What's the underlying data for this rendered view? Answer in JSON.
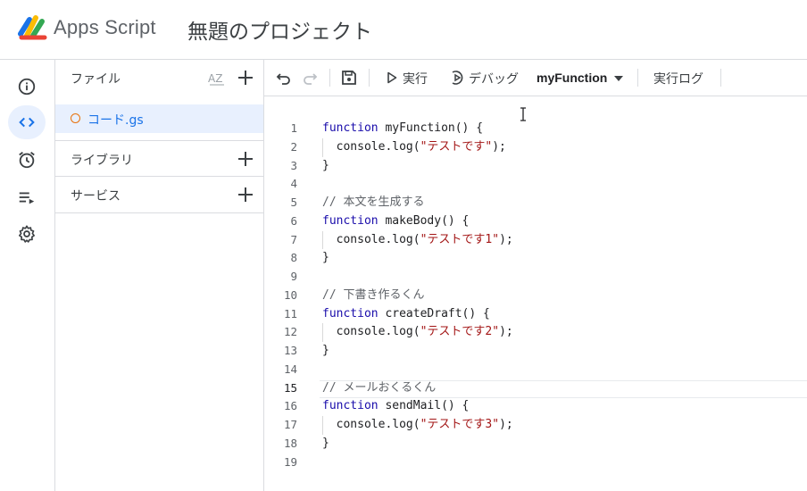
{
  "header": {
    "app_name": "Apps Script",
    "project_title": "無題のプロジェクト"
  },
  "rail": {
    "items": [
      "info-icon",
      "code-icon",
      "alarm-icon",
      "executions-icon",
      "gear-icon"
    ],
    "active_index": 1
  },
  "files_panel": {
    "title": "ファイル",
    "files": [
      {
        "name": "コード.gs",
        "selected": true
      }
    ],
    "libraries_label": "ライブラリ",
    "services_label": "サービス"
  },
  "toolbar": {
    "run_label": "実行",
    "debug_label": "デバッグ",
    "function_selected": "myFunction",
    "log_label": "実行ログ"
  },
  "editor": {
    "current_line": 15,
    "lines": [
      "function myFunction() {",
      "  console.log(\"テストです\");",
      "}",
      "",
      "// 本文を生成する",
      "function makeBody() {",
      "  console.log(\"テストです1\");",
      "}",
      "",
      "// 下書き作るくん",
      "function createDraft() {",
      "  console.log(\"テストです2\");",
      "}",
      "",
      "// メールおくるくん",
      "function sendMail() {",
      "  console.log(\"テストです3\");",
      "}",
      ""
    ]
  },
  "colors": {
    "accent": "#1a73e8",
    "active_bg": "#e8f0fe",
    "keyword": "#1a0dab",
    "string": "#a31515",
    "comment": "#5f6368",
    "file_dot": "#e8710a"
  }
}
